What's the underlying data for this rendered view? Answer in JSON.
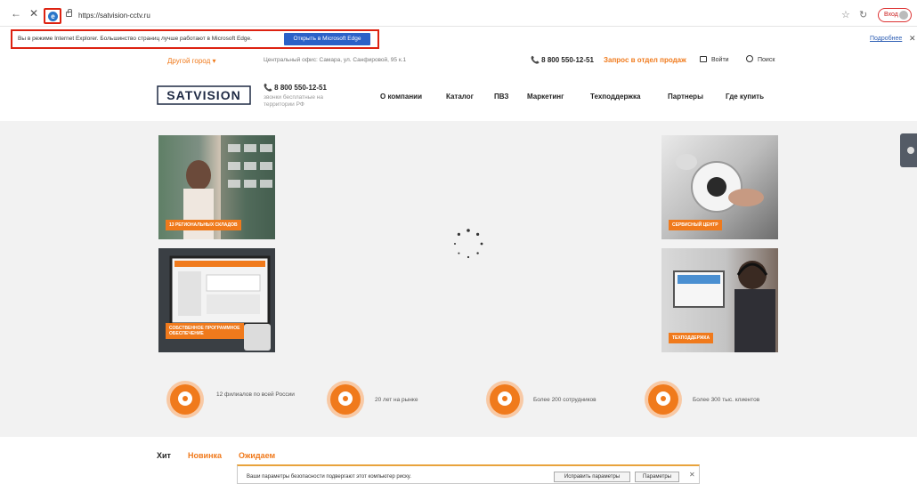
{
  "browser": {
    "back_glyph": "←",
    "stop_glyph": "✕",
    "ie_glyph": "e",
    "url": "https://satvision-cctv.ru",
    "favorite_glyph": "☆",
    "refresh_glyph": "↻",
    "login_label": "Вход"
  },
  "ie_bar": {
    "message": "Вы в режиме Internet Explorer. Большинство страниц лучше работают в Microsoft Edge.",
    "edge_button": "Открыть в Microsoft Edge",
    "more_link": "Подробнее",
    "close_glyph": "✕"
  },
  "site": {
    "city": "Другой город ▾",
    "office": "Центральный офис: Самара, ул. Санфировой, 95 к.1",
    "phone_top": "📞 8 800 550-12-51",
    "request": "Запрос в отдел продаж",
    "login": "Войти",
    "search": "Поиск",
    "logo_text": "SATVISION",
    "phone_main": "📞 8 800 550-12-51",
    "phone_note": "звонки бесплатные на территории РФ",
    "menu": [
      "О компании",
      "Каталог",
      "ПВЗ",
      "Маркетинг",
      "Техподдержка",
      "Партнеры",
      "Где купить"
    ]
  },
  "hero": {
    "tiles": [
      {
        "badge": "13 РЕГИОНАЛЬНЫХ СКЛАДОВ"
      },
      {
        "badge": "СЕРВИСНЫЙ ЦЕНТР"
      },
      {
        "badge": "СОБСТВЕННОЕ ПРОГРАММНОЕ ОБЕСПЕЧЕНИЕ"
      },
      {
        "badge": "ТЕХПОДДЕРЖКА"
      }
    ],
    "stats": [
      {
        "text": "12 филиалов по всей России"
      },
      {
        "text": "20 лет на рынке"
      },
      {
        "text": "Более 200 сотрудников"
      },
      {
        "text": "Более 300 тыс. клиентов"
      }
    ]
  },
  "tabs": [
    "Хит",
    "Новинка",
    "Ожидаем"
  ],
  "security_warning": {
    "message": "Ваши параметры безопасности подвергают этот компьютер риску.",
    "fix_button": "Исправить параметры",
    "params_button": "Параметры",
    "close_glyph": "✕"
  },
  "colors": {
    "accent": "#f07a1c",
    "edge_blue": "#2b61c8",
    "highlight_red": "#dd2211"
  }
}
